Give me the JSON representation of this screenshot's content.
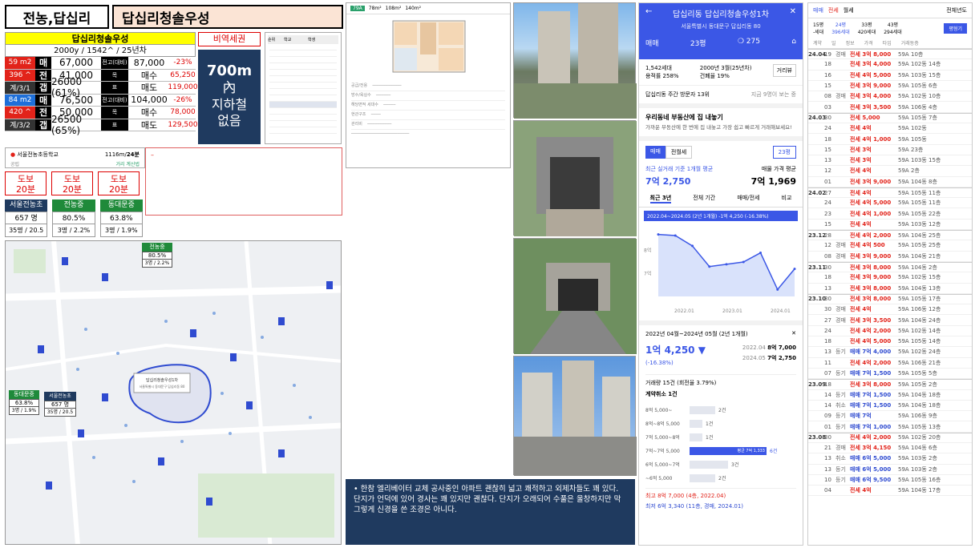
{
  "header": {
    "location": "전농,답십리",
    "apartment": "답십리청솔우성"
  },
  "info": {
    "name": "답십리청솔우성",
    "summary": "2000y / 1542^ / 25년차",
    "rows": [
      {
        "c1": "59 m2",
        "c2": "매",
        "c3": "67,000",
        "c4": "전고(대비)",
        "c5": "87,000",
        "c6": "-23%",
        "c1color": "#e2231a"
      },
      {
        "c1": "396 ^",
        "c2": "전",
        "c3": "41,000",
        "c4": "목",
        "c5": "매수",
        "c6": "65,250",
        "c1color": "#e2231a"
      },
      {
        "c1": "계/3/1",
        "c2": "갭",
        "c3": "26000 (61%)",
        "c4": "표",
        "c5": "매도",
        "c6": "119,000",
        "c1color": "#333"
      },
      {
        "c1": "84 m2",
        "c2": "매",
        "c3": "76,500",
        "c4": "전고(대비)",
        "c5": "104,000",
        "c6": "-26%",
        "c1color": "#1e6fd9"
      },
      {
        "c1": "420 ^",
        "c2": "전",
        "c3": "50,000",
        "c4": "목",
        "c5": "매수",
        "c6": "78,000",
        "c1color": "#e2231a"
      },
      {
        "c1": "계/3/2",
        "c2": "갭",
        "c3": "26500 (65%)",
        "c4": "표",
        "c5": "매도",
        "c6": "129,500",
        "c1color": "#333"
      }
    ]
  },
  "station": {
    "tag": "비역세권",
    "distance": "700m",
    "line1": "內",
    "line2": "지하철",
    "line3": "없음"
  },
  "school_info": {
    "name": "서울전농초등학교",
    "distance": "1116m/",
    "time": "24분",
    "kind": "공립",
    "link": "거리 계산법"
  },
  "walk": [
    {
      "label": "도보",
      "time": "20분"
    },
    {
      "label": "도보",
      "time": "20분"
    },
    {
      "label": "도보",
      "time": "20분"
    }
  ],
  "schools": [
    {
      "name": "서울전농초",
      "color": "#1f3a5f",
      "val1": "657 명",
      "val2": "35명 / 20.5"
    },
    {
      "name": "전농중",
      "color": "#1f8a3a",
      "val1": "80.5%",
      "val2": "3명 / 2.2%"
    },
    {
      "name": "동대문중",
      "color": "#1f8a3a",
      "val1": "63.8%",
      "val2": "3명 / 1.9%"
    }
  ],
  "map": {
    "labels": [
      {
        "name": "전농중",
        "v1": "80.5%",
        "v2": "3명 / 2.2%"
      },
      {
        "name": "동대문중",
        "v1": "63.8%",
        "v2": "3명 / 1.9%"
      },
      {
        "name": "서울전농초",
        "v1": "657 명",
        "v2": "35명 / 20.5"
      }
    ]
  },
  "comment": "한참 엘리베이터 교체 공사중인 아파트 괜찮히 넓고 쾌적하고 외제차들도 꽤 있다. 단지가 언덕에 있어 경사는 꽤 있지만 괜찮다. 단지가 오래되어 수풀은 울창하지만 막 그렇게 신경을 쓴 조경은 아니다.",
  "plan": {
    "tabs": [
      "79A",
      "78m²",
      "108m²",
      "140m²"
    ]
  },
  "mobile": {
    "title": "답십리동 답십리청솔우성1차",
    "address": "서울특별시 동대문구 답십리동 80",
    "trade_type": "매매",
    "size": "23평",
    "comments": "275",
    "household": "1,542세대",
    "built": "2000년 3월(25년차)",
    "ratio1": "용적률 258%",
    "ratio2": "건폐율 19%",
    "review_btn": "거리뷰",
    "visitors": "답십리동 주간 방문자 13위",
    "visitors_now": "지금 9명이 보는 중",
    "promo_title": "우리동네 부동산에 집 내놓기",
    "promo_text": "가까운 부동산에 한 번에 집 내놓고 가장 쉽고 빠르게 거래해보세요!",
    "tab_sale": "매매",
    "tab_rent": "전월세",
    "size2": "23평",
    "avg_label": "최근 실거래 기준 1개월 평균",
    "avg_price": "7억 2,750",
    "ask_label": "매물 가격 평균",
    "ask_price": "7억 1,969",
    "period_tabs": [
      "최근 3년",
      "전체 기간",
      "매매/전세",
      "비교"
    ],
    "chart_label": "2022.04~2024.05 (2년 1개월) -1억 4,250 (-16.38%)",
    "change_title": "2022년 04월~2024년 05월 (2년 1개월)",
    "change": "1억 4,250 ▼",
    "change_pct": "(-16.38%)",
    "hist": [
      {
        "d": "2022.04",
        "p": "8억 7,000"
      },
      {
        "d": "2024.05",
        "p": "7억 2,750"
      }
    ],
    "trade_count": "거래량 15건 (회전율 3.79%)",
    "cancel": "계약취소 1건",
    "bars": [
      {
        "r": "8억 5,000~",
        "n": "2건",
        "v": 2
      },
      {
        "r": "8억~8억 5,000",
        "n": "1건",
        "v": 1
      },
      {
        "r": "7억 5,000~8억",
        "n": "1건",
        "v": 1
      },
      {
        "r": "7억~7억 5,000",
        "n": "6건",
        "v": 6
      },
      {
        "r": "6억 5,000~7억",
        "n": "3건",
        "v": 3
      },
      {
        "r": "~6억 5,000",
        "n": "2건",
        "v": 2
      }
    ],
    "avg_tag": "평균 7억 1,333",
    "max": "최고 8억 7,000 (4층, 2022.04)",
    "min": "최저 6억 3,340 (11층, 경매, 2024.01)"
  },
  "chart_data": {
    "type": "line",
    "x": [
      "2022.04",
      "2022.07",
      "2022.10",
      "2023.01",
      "2023.04",
      "2023.07",
      "2023.10",
      "2024.01",
      "2024.05"
    ],
    "y": [
      8.7,
      8.65,
      8.2,
      7.3,
      7.4,
      7.5,
      7.9,
      6.3,
      7.2
    ],
    "yticks": [
      "8억",
      "7억"
    ],
    "xticks": [
      "2022.01",
      "2023.01",
      "2024.01"
    ]
  },
  "list": {
    "tabs": [
      "매매",
      "전세",
      "월세"
    ],
    "year_select": "전체년도",
    "sizes": [
      "15평",
      "24평",
      "33평",
      "43평"
    ],
    "households": [
      "-세대",
      "396세대",
      "420세대",
      "294세대"
    ],
    "btn": "평형기",
    "rows": [
      {
        "m": "24.04",
        "d": "19",
        "t": "경매",
        "p": "전세 3억 8,000",
        "a": "59A",
        "b": "10층"
      },
      {
        "m": "",
        "d": "18",
        "t": "",
        "p": "전세 3억 4,000",
        "a": "59A",
        "b": "102동 14층"
      },
      {
        "m": "",
        "d": "16",
        "t": "",
        "p": "전세 4억 5,000",
        "a": "59A",
        "b": "103동 15층"
      },
      {
        "m": "",
        "d": "15",
        "t": "",
        "p": "전세 3억 9,000",
        "a": "59A",
        "b": "105동 6층"
      },
      {
        "m": "",
        "d": "08",
        "t": "경매",
        "p": "전세 3억 4,000",
        "a": "59A",
        "b": "102동 10층"
      },
      {
        "m": "",
        "d": "03",
        "t": "",
        "p": "전세 3억 3,500",
        "a": "59A",
        "b": "106동 4층"
      },
      {
        "m": "24.03",
        "d": "30",
        "t": "",
        "p": "전세 5,000",
        "a": "59A",
        "b": "105동 7층"
      },
      {
        "m": "",
        "d": "24",
        "t": "",
        "p": "전세 4억",
        "a": "59A",
        "b": "102동"
      },
      {
        "m": "",
        "d": "18",
        "t": "",
        "p": "전세 4억 1,000",
        "a": "59A",
        "b": "105동"
      },
      {
        "m": "",
        "d": "15",
        "t": "",
        "p": "전세 3억",
        "a": "59A",
        "b": "23층"
      },
      {
        "m": "",
        "d": "13",
        "t": "",
        "p": "전세 3억",
        "a": "59A",
        "b": "103동 15층"
      },
      {
        "m": "",
        "d": "12",
        "t": "",
        "p": "전세 4억",
        "a": "59A",
        "b": "2층"
      },
      {
        "m": "",
        "d": "01",
        "t": "",
        "p": "전세 3억 9,000",
        "a": "59A",
        "b": "104동 8층"
      },
      {
        "m": "24.02",
        "d": "27",
        "t": "",
        "p": "전세 4억",
        "a": "59A",
        "b": "105동 11층"
      },
      {
        "m": "",
        "d": "24",
        "t": "",
        "p": "전세 4억 5,000",
        "a": "59A",
        "b": "105동 11층"
      },
      {
        "m": "",
        "d": "23",
        "t": "",
        "p": "전세 4억 1,000",
        "a": "59A",
        "b": "105동 22층"
      },
      {
        "m": "",
        "d": "15",
        "t": "",
        "p": "전세 4억",
        "a": "59A",
        "b": "103동 12층"
      },
      {
        "m": "23.12",
        "d": "28",
        "t": "",
        "p": "전세 4억 2,000",
        "a": "59A",
        "b": "104동 25층"
      },
      {
        "m": "",
        "d": "12",
        "t": "경매",
        "p": "전세 4억 500",
        "a": "59A",
        "b": "105동 25층"
      },
      {
        "m": "",
        "d": "08",
        "t": "경매",
        "p": "전세 3억 9,000",
        "a": "59A",
        "b": "104동 21층"
      },
      {
        "m": "23.11",
        "d": "30",
        "t": "",
        "p": "전세 3억 8,000",
        "a": "59A",
        "b": "104동 2층"
      },
      {
        "m": "",
        "d": "18",
        "t": "",
        "p": "전세 3억 9,000",
        "a": "59A",
        "b": "102동 15층"
      },
      {
        "m": "",
        "d": "13",
        "t": "",
        "p": "전세 3억 8,000",
        "a": "59A",
        "b": "104동 13층"
      },
      {
        "m": "23.10",
        "d": "30",
        "t": "",
        "p": "전세 3억 8,000",
        "a": "59A",
        "b": "105동 17층"
      },
      {
        "m": "",
        "d": "30",
        "t": "경매",
        "p": "전세 4억",
        "a": "59A",
        "b": "106동 12층"
      },
      {
        "m": "",
        "d": "27",
        "t": "경매",
        "p": "전세 3억 3,500",
        "a": "59A",
        "b": "104동 24층"
      },
      {
        "m": "",
        "d": "24",
        "t": "",
        "p": "전세 4억 2,000",
        "a": "59A",
        "b": "102동 14층"
      },
      {
        "m": "",
        "d": "18",
        "t": "",
        "p": "전세 4억 5,000",
        "a": "59A",
        "b": "105동 14층"
      },
      {
        "m": "",
        "d": "13",
        "t": "등기",
        "p": "매매 7억 4,000",
        "a": "59A",
        "b": "102동 24층"
      },
      {
        "m": "",
        "d": "11",
        "t": "",
        "p": "전세 4억 2,000",
        "a": "59A",
        "b": "106동 21층"
      },
      {
        "m": "",
        "d": "07",
        "t": "등기",
        "p": "매매 7억 1,500",
        "a": "59A",
        "b": "105동 5층"
      },
      {
        "m": "23.09",
        "d": "18",
        "t": "",
        "p": "전세 3억 8,000",
        "a": "59A",
        "b": "105동 2층"
      },
      {
        "m": "",
        "d": "14",
        "t": "등기",
        "p": "매매 7억 1,500",
        "a": "59A",
        "b": "104동 18층"
      },
      {
        "m": "",
        "d": "14",
        "t": "취소",
        "p": "매매 7억 1,500",
        "a": "59A",
        "b": "104동 18층"
      },
      {
        "m": "",
        "d": "09",
        "t": "등기",
        "p": "매매 7억",
        "a": "59A",
        "b": "106동 9층"
      },
      {
        "m": "",
        "d": "01",
        "t": "등기",
        "p": "매매 7억 1,000",
        "a": "59A",
        "b": "105동 13층"
      },
      {
        "m": "23.08",
        "d": "30",
        "t": "",
        "p": "전세 4억 2,000",
        "a": "59A",
        "b": "102동 20층"
      },
      {
        "m": "",
        "d": "21",
        "t": "경매",
        "p": "전세 3억 4,150",
        "a": "59A",
        "b": "104동 6층"
      },
      {
        "m": "",
        "d": "13",
        "t": "취소",
        "p": "매매 6억 5,000",
        "a": "59A",
        "b": "103동 2층"
      },
      {
        "m": "",
        "d": "13",
        "t": "등기",
        "p": "매매 6억 5,000",
        "a": "59A",
        "b": "103동 2층"
      },
      {
        "m": "",
        "d": "10",
        "t": "등기",
        "p": "매매 6억 9,500",
        "a": "59A",
        "b": "105동 16층"
      },
      {
        "m": "",
        "d": "04",
        "t": "",
        "p": "전세 4억",
        "a": "59A",
        "b": "104동 17층"
      }
    ]
  }
}
